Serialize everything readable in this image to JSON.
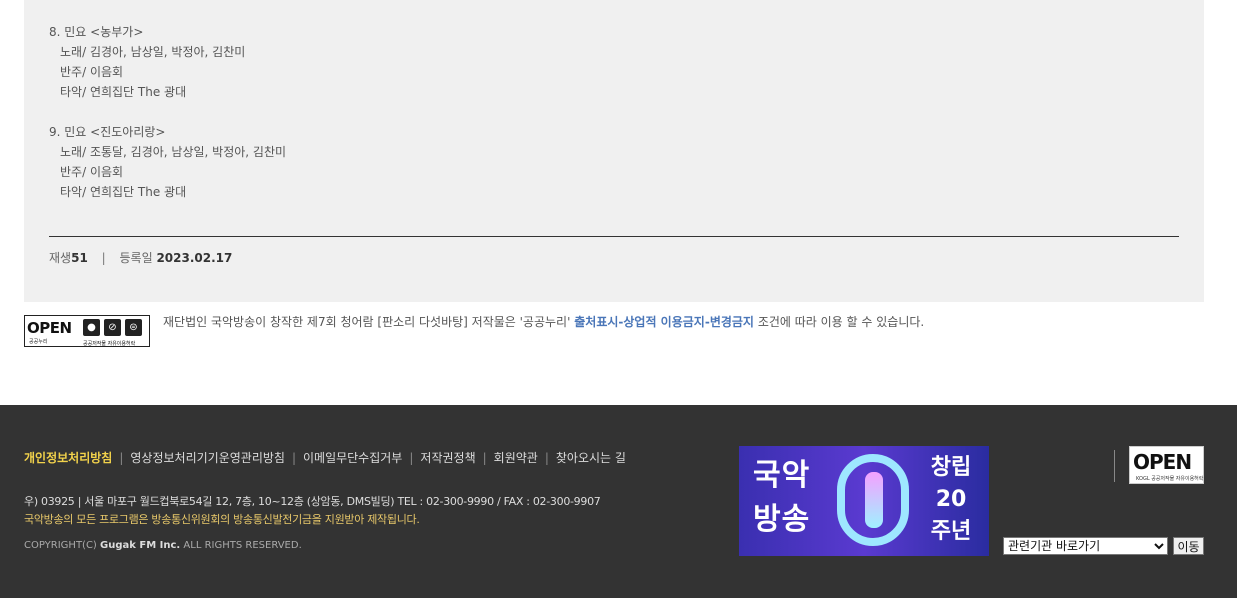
{
  "tracks": [
    {
      "title": "8. 민요 <농부가>",
      "lines": [
        "노래/ 김경아, 남상일, 박정아, 김찬미",
        "반주/ 이음회",
        "타악/ 연희집단 The 광대"
      ]
    },
    {
      "title": "9. 민요 <진도아리랑>",
      "lines": [
        "노래/ 조통달, 김경아, 남상일, 박정아, 김찬미",
        "반주/ 이음회",
        "타악/ 연희집단 The 광대"
      ]
    }
  ],
  "meta": {
    "play_label": "재생",
    "play_count": "51",
    "separator": "|",
    "date_label": "등록일",
    "date_value": "2023.02.17"
  },
  "license": {
    "badge_text": "OPEN",
    "badge_sub": "공공누리",
    "badge_cc_sub": "공공저작물 자유이용허락",
    "text_before": "재단법인 국악방송이 창작한 제7회 청어람 [판소리 다섯바탕] 저작물은 '공공누리'",
    "text_highlight": "출처표시-상업적 이용금지-변경금지",
    "text_after": "조건에 따라 이용 할 수 있습니다."
  },
  "footer": {
    "nav": [
      {
        "label": "개인정보처리방침",
        "primary": true
      },
      {
        "label": "영상정보처리기기운영관리방침",
        "primary": false
      },
      {
        "label": "이메일무단수집거부",
        "primary": false
      },
      {
        "label": "저작권정책",
        "primary": false
      },
      {
        "label": "회원약관",
        "primary": false
      },
      {
        "label": "찾아오시는 길",
        "primary": false
      }
    ],
    "nav_separator": "|",
    "address": "우) 03925 | 서울 마포구 월드컵북로54길 12, 7층, 10~12층 (상암동, DMS빌딩) TEL : 02-300-9990 / FAX : 02-300-9907",
    "funding": "국악방송의 모든 프로그램은 방송통신위원회의 방송통신발전기금을 지원받아 제작됩니다.",
    "copyright_prefix": "COPYRIGHT(C)",
    "copyright_brand": "Gugak FM Inc.",
    "copyright_suffix": "ALL RIGHTS RESERVED.",
    "banner": {
      "left_line1": "국악",
      "left_line2": "방송",
      "right_line1": "창립",
      "right_line2": "20",
      "right_line3": "주년"
    },
    "kogl_text": "OPEN",
    "kogl_sub": "KOGL 공공저작물 자유이용허락",
    "related_select": {
      "selected": "관련기관 바로가기"
    },
    "go_button": "이동"
  },
  "colors": {
    "footer_bg": "#333333",
    "nav_primary": "#f2d24b",
    "license_highlight": "#4a76b8",
    "panel_bg": "#f0f0f0"
  }
}
